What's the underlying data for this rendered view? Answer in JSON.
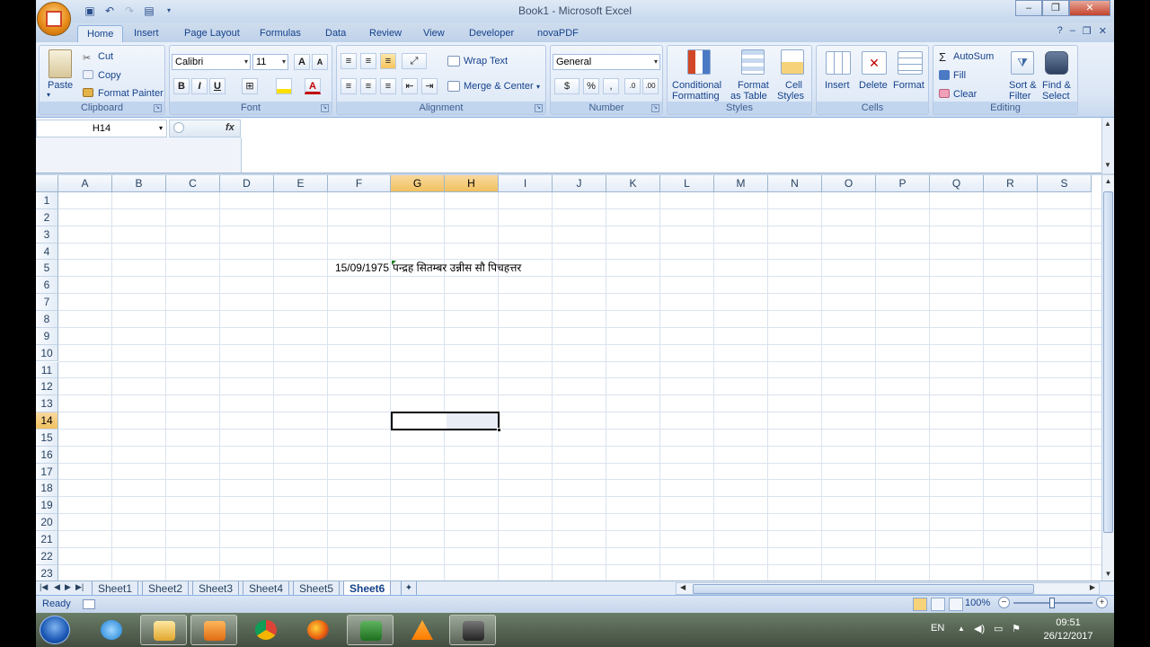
{
  "window": {
    "title": "Book1 - Microsoft Excel"
  },
  "ribbon_tabs": [
    "Home",
    "Insert",
    "Page Layout",
    "Formulas",
    "Data",
    "Review",
    "View",
    "Developer",
    "novaPDF"
  ],
  "clipboard": {
    "paste": "Paste",
    "cut": "Cut",
    "copy": "Copy",
    "format_painter": "Format Painter",
    "group": "Clipboard"
  },
  "font": {
    "name": "Calibri",
    "size": "11",
    "group": "Font",
    "bold": "B",
    "italic": "I",
    "underline": "U",
    "grow": "A",
    "shrink": "A"
  },
  "alignment": {
    "wrap": "Wrap Text",
    "merge": "Merge & Center",
    "group": "Alignment"
  },
  "number": {
    "format": "General",
    "percent": "%",
    "comma": ",",
    "group": "Number"
  },
  "styles": {
    "conditional_1": "Conditional",
    "conditional_2": "Formatting",
    "table_1": "Format",
    "table_2": "as Table",
    "cell_1": "Cell",
    "cell_2": "Styles",
    "group": "Styles"
  },
  "cells": {
    "insert": "Insert",
    "delete": "Delete",
    "format": "Format",
    "group": "Cells"
  },
  "editing": {
    "autosum": "AutoSum",
    "fill": "Fill",
    "clear": "Clear",
    "sort_1": "Sort &",
    "sort_2": "Filter",
    "find_1": "Find &",
    "find_2": "Select",
    "group": "Editing"
  },
  "formula_bar": {
    "name_box": "H14",
    "fx": "fx",
    "content": ""
  },
  "columns": [
    "A",
    "B",
    "C",
    "D",
    "E",
    "F",
    "G",
    "H",
    "I",
    "J",
    "K",
    "L",
    "M",
    "N",
    "O",
    "P",
    "Q",
    "R",
    "S"
  ],
  "rows": [
    "1",
    "2",
    "3",
    "4",
    "5",
    "6",
    "7",
    "8",
    "9",
    "10",
    "11",
    "12",
    "13",
    "14",
    "15",
    "16",
    "17",
    "18",
    "19",
    "20",
    "21",
    "22",
    "23"
  ],
  "cells_data": {
    "F5": "15/09/1975",
    "G5": "पन्द्रह सितम्बर उन्नीस सौ पिचहत्तर"
  },
  "selected_cell": "H14",
  "sheets": [
    "Sheet1",
    "Sheet2",
    "Sheet3",
    "Sheet4",
    "Sheet5",
    "Sheet6"
  ],
  "active_sheet": "Sheet6",
  "status": {
    "text": "Ready",
    "zoom": "100%"
  },
  "taskbar": {
    "lang": "EN",
    "time": "09:51",
    "date": "26/12/2017"
  },
  "colors": {
    "selected_header": "#f1c15f",
    "ribbon_bg": "#dbe6f5",
    "grid_line": "#dae3ee"
  }
}
